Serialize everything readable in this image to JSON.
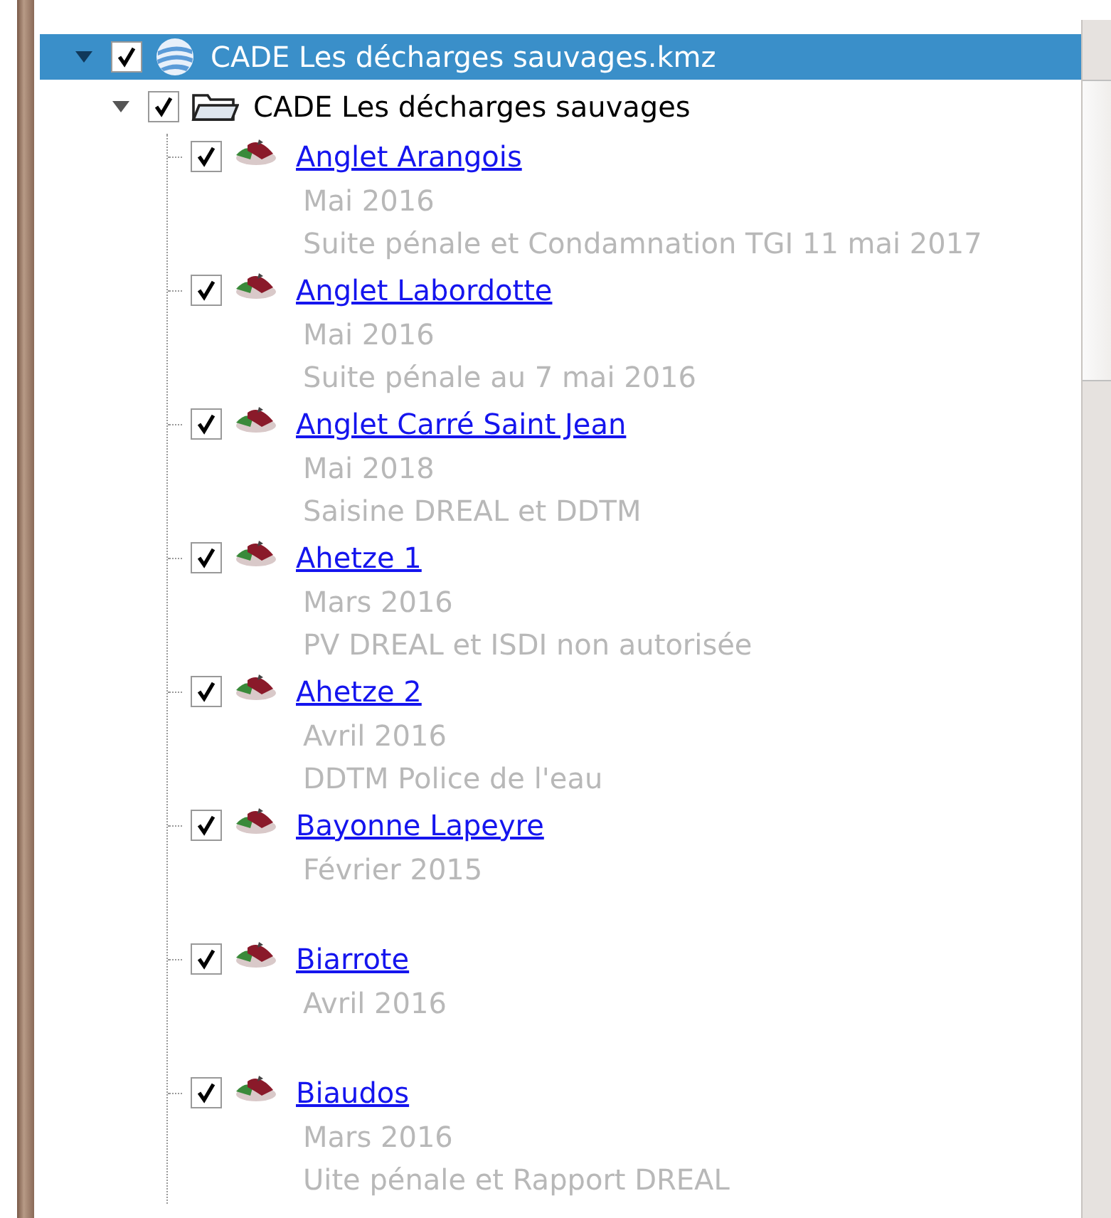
{
  "tree": [
    {
      "kind": "kmz",
      "label": "CADE Les décharges sauvages.kmz",
      "checked": true,
      "expanded": true,
      "selected": true,
      "children": [
        {
          "kind": "folder",
          "label": "CADE Les décharges sauvages",
          "checked": true,
          "expanded": true,
          "selected": false,
          "children": [
            {
              "kind": "placemark",
              "label": "Anglet Arangois",
              "checked": true,
              "lines": [
                "Mai 2016",
                "Suite pénale et Condamnation TGI 11 mai 2017"
              ]
            },
            {
              "kind": "placemark",
              "label": "Anglet Labordotte",
              "checked": true,
              "lines": [
                "Mai 2016",
                "Suite pénale au 7 mai 2016"
              ]
            },
            {
              "kind": "placemark",
              "label": "Anglet Carré Saint Jean",
              "checked": true,
              "lines": [
                "Mai 2018",
                "Saisine DREAL et DDTM"
              ]
            },
            {
              "kind": "placemark",
              "label": "Ahetze 1",
              "checked": true,
              "lines": [
                "Mars 2016",
                "PV DREAL et ISDI non autorisée"
              ]
            },
            {
              "kind": "placemark",
              "label": "Ahetze 2",
              "checked": true,
              "lines": [
                "Avril 2016",
                "DDTM Police de l'eau"
              ]
            },
            {
              "kind": "placemark",
              "label": "Bayonne Lapeyre",
              "checked": true,
              "lines": [
                "Février 2015"
              ]
            },
            {
              "kind": "placemark",
              "label": "Biarrote",
              "checked": true,
              "lines": [
                "Avril 2016"
              ]
            },
            {
              "kind": "placemark",
              "label": "Biaudos",
              "checked": true,
              "lines": [
                "Mars 2016",
                "Uite pénale et Rapport DREAL"
              ]
            }
          ]
        }
      ]
    }
  ]
}
